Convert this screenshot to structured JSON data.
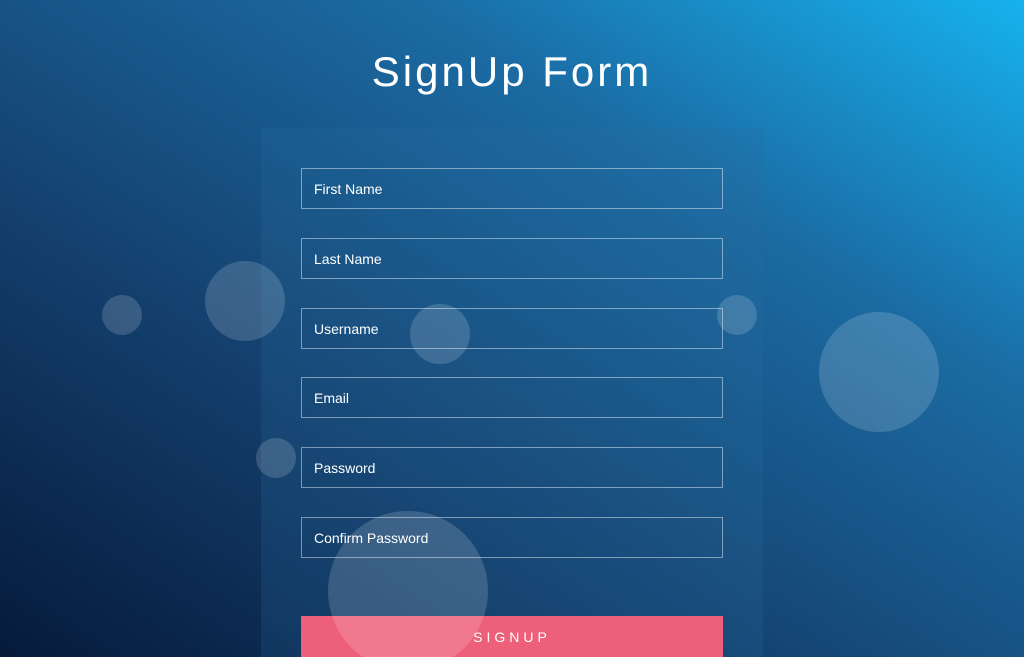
{
  "page": {
    "title": "SignUp Form"
  },
  "form": {
    "fields": [
      {
        "name": "first-name-input",
        "placeholder": "First Name"
      },
      {
        "name": "last-name-input",
        "placeholder": "Last Name"
      },
      {
        "name": "username-input",
        "placeholder": "Username"
      },
      {
        "name": "email-input",
        "placeholder": "Email"
      },
      {
        "name": "password-input",
        "placeholder": "Password"
      },
      {
        "name": "confirm-password-input",
        "placeholder": "Confirm Password"
      }
    ],
    "submit_label": "SIGNUP",
    "submit_color": "#ee5f7a"
  },
  "theme": {
    "background_gradient": [
      "#061a3b",
      "#14406e",
      "#1b6ba3",
      "#16b2ee"
    ]
  }
}
